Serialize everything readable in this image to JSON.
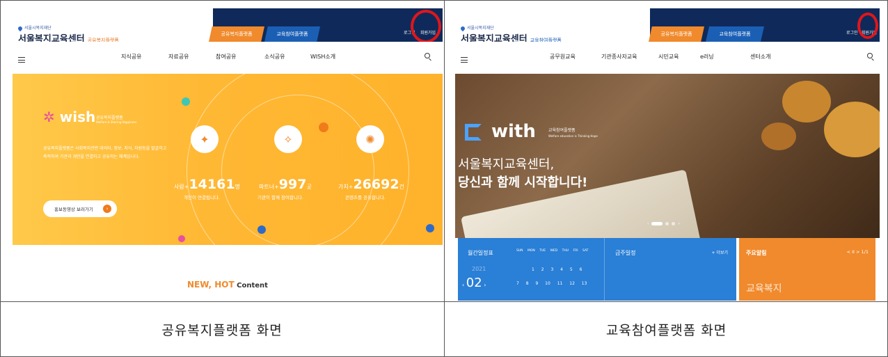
{
  "left": {
    "org": "서울시복지재단",
    "site_title": "서울복지교육센터",
    "platform_name": "공유복지플랫폼",
    "tabs": [
      "공유복지플랫폼",
      "교육참여플랫폼"
    ],
    "login": "로그인",
    "join": "회원가입",
    "nav": [
      "지식공유",
      "자료공유",
      "참여공유",
      "소식공유",
      "WISH소개"
    ],
    "hero": {
      "brand": "wish",
      "brand_tag": "공유복지플랫폼",
      "brand_sub": "Welfare & Sharing Happiness",
      "desc": "공유복지플랫폼은 사회복지관련 데이터, 정보, 지식, 자원등을 발굴하고 축적하여 기관과 개인을 연결하고 공유하는 체계입니다.",
      "promo": "홍보동영상 보러가기",
      "stats": [
        {
          "label": "사람+",
          "value": "14161",
          "unit": "명",
          "sub": "개인이 연결됩니다."
        },
        {
          "label": "파트너+",
          "value": "997",
          "unit": "곳",
          "sub": "기관이 함께 참여합니다."
        },
        {
          "label": "가치+",
          "value": "26692",
          "unit": "건",
          "sub": "콘텐츠를 공유합니다."
        }
      ]
    },
    "section_title_accent": "NEW, HOT",
    "section_title_rest": " Content"
  },
  "right": {
    "org": "서울시복지재단",
    "site_title": "서울복지교육센터",
    "platform_name": "교육참여플랫폼",
    "tabs": [
      "공유복지플랫폼",
      "교육참여플랫폼"
    ],
    "login": "로그인",
    "join": "회원가입",
    "nav": [
      "공무원교육",
      "기관종사자교육",
      "시민교육",
      "e러닝",
      "센터소개"
    ],
    "hero": {
      "brand": "with",
      "brand_tag": "교육참여플랫폼",
      "brand_sub": "Welfare education is Thinking Hope",
      "line1": "서울복지교육센터,",
      "line2": "당신과 함께 시작합니다!"
    },
    "calendar": {
      "title": "월간일정표",
      "year": "2021",
      "month": "02",
      "days_header": "SUN MON TUE WED THU FRI SAT",
      "week1": "1 2 3 4 5 6",
      "week2": "7 8 9 10 11 12 13"
    },
    "weekly": {
      "title": "금주일정",
      "more": "+ 더보기"
    },
    "notice": {
      "title": "주요알림",
      "pager": "< II >  1/1",
      "text": "교육복지"
    }
  },
  "captions": [
    "공유복지플랫폼 화면",
    "교육참여플랫폼 화면"
  ],
  "colors": {
    "navy": "#0f2a5a",
    "orange": "#f08a2c",
    "blue": "#1b5fb5",
    "yellow": "#ffb834",
    "cal_blue": "#2a7fd6",
    "annotation_red": "#e0161b"
  }
}
